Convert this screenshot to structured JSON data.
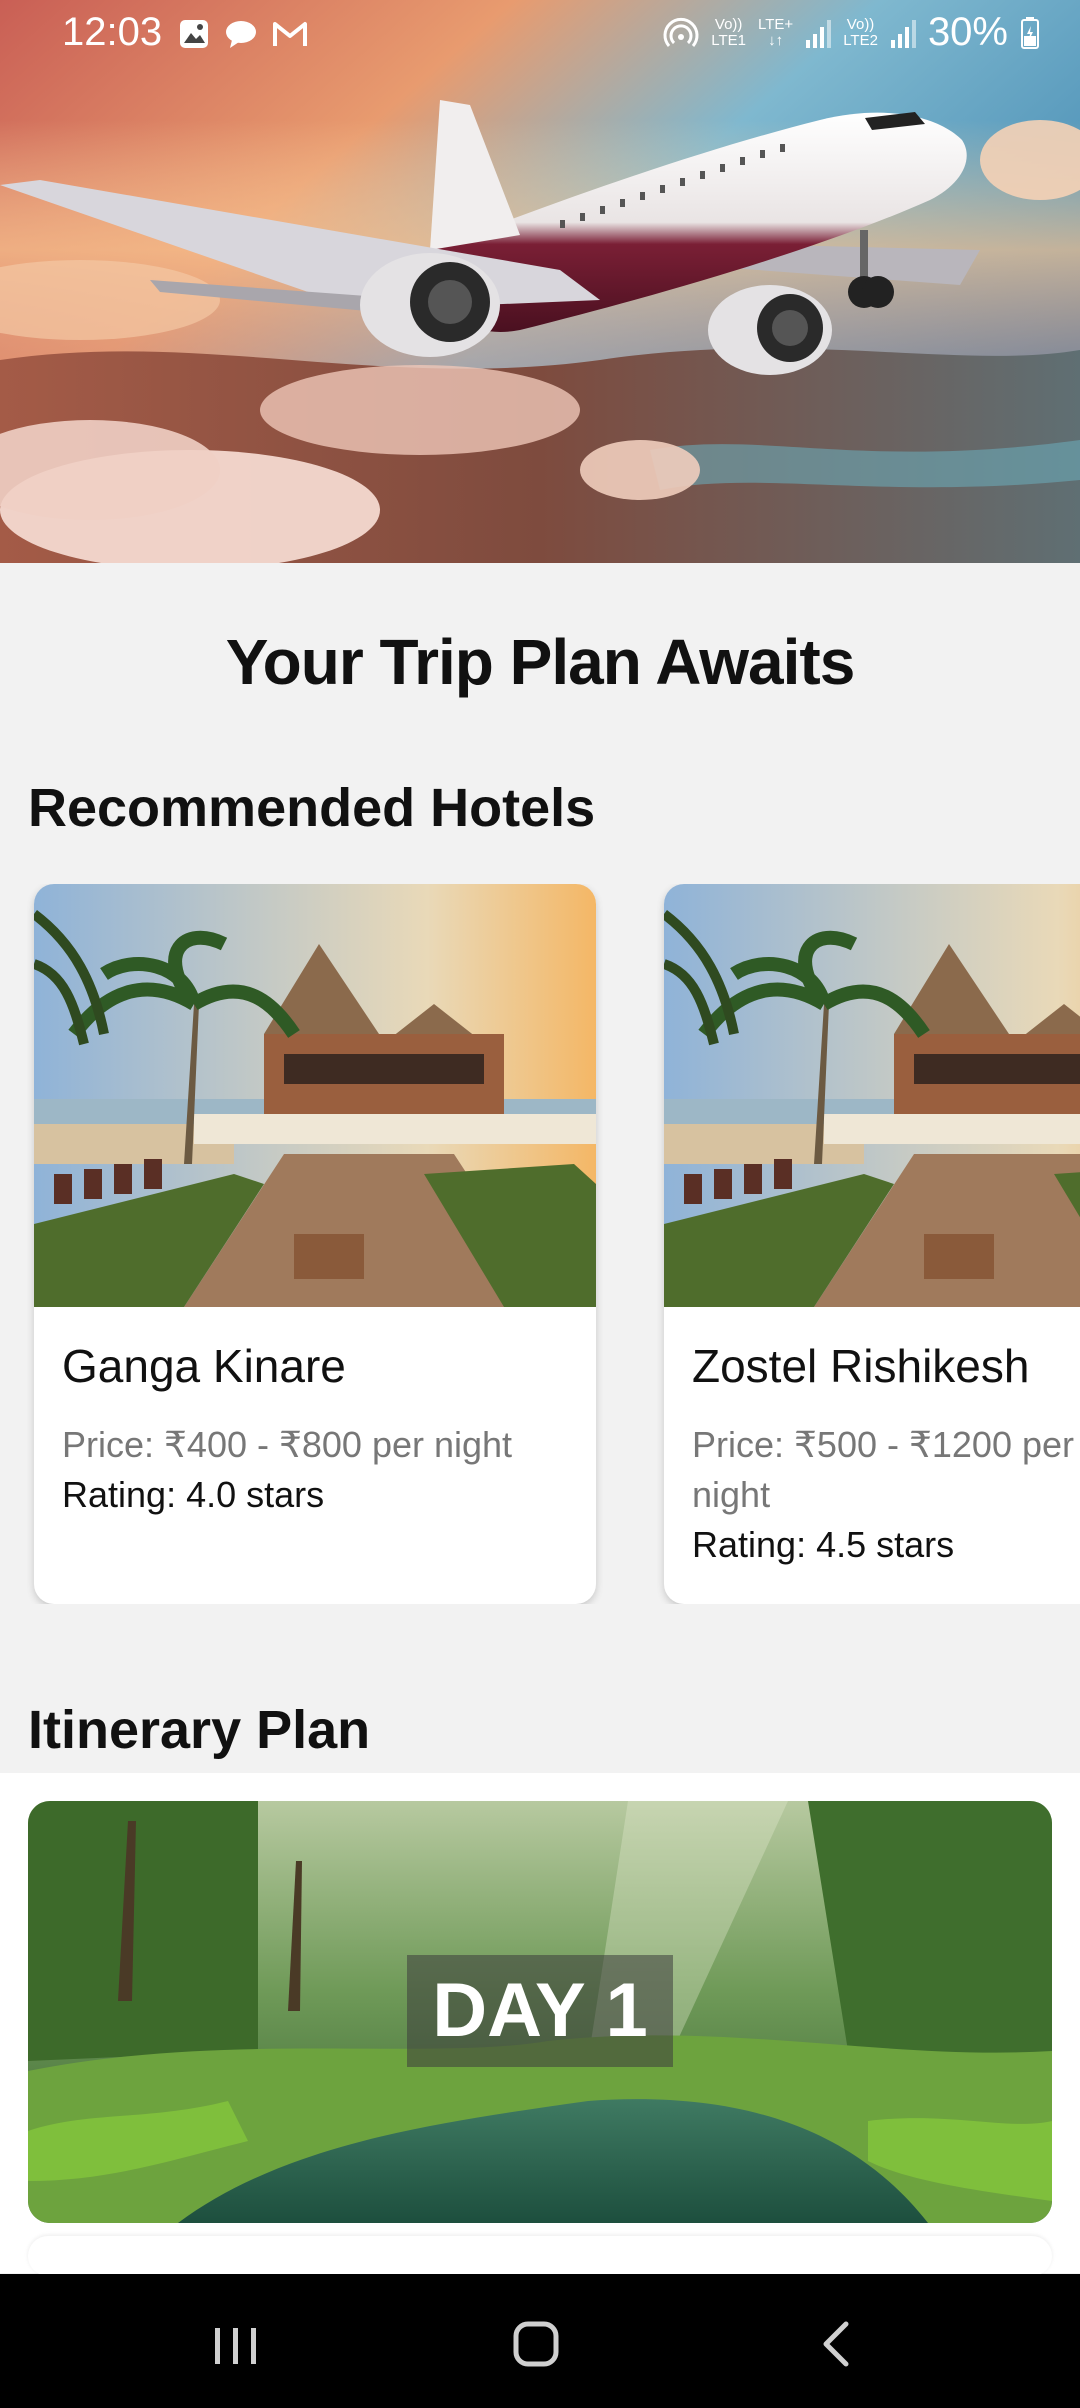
{
  "status_bar": {
    "time": "12:03",
    "left_icons": [
      "gallery-icon",
      "chat-icon",
      "gmail-icon"
    ],
    "network_labels": [
      "Vo))",
      "LTE1",
      "LTE+",
      "Vo))",
      "LTE2"
    ],
    "battery": "30%"
  },
  "hero": {
    "image": "airplane-over-clouds-sunset"
  },
  "page": {
    "title": "Your Trip Plan Awaits"
  },
  "hotels": {
    "section_title": "Recommended Hotels",
    "items": [
      {
        "name": "Ganga Kinare",
        "price": "Price: ₹400 - ₹800 per night",
        "rating": "Rating: 4.0 stars"
      },
      {
        "name": "Zostel Rishikesh",
        "price": "Price: ₹500 - ₹1200 per night",
        "rating": "Rating: 4.5 stars"
      }
    ]
  },
  "itinerary": {
    "section_title": "Itinerary Plan",
    "days": [
      {
        "label": "DAY 1"
      }
    ]
  },
  "nav": {
    "icons": [
      "recent-apps-icon",
      "home-icon",
      "back-icon"
    ]
  },
  "colors": {
    "background": "#f2f2f2",
    "card": "#ffffff",
    "price_text": "#777777",
    "nav_bar": "#000000"
  }
}
